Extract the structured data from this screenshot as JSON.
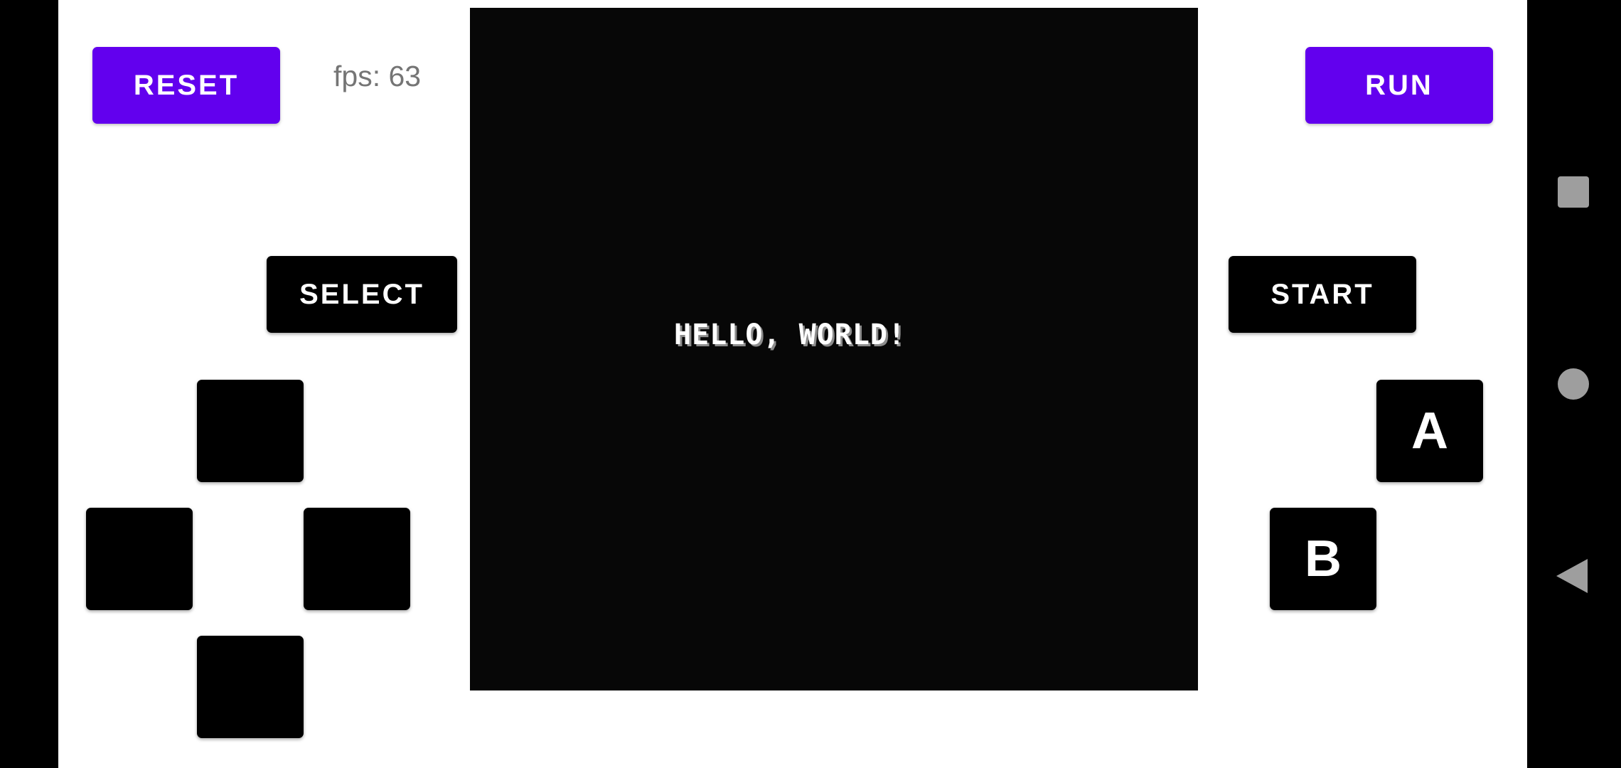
{
  "toolbar": {
    "reset_label": "RESET",
    "run_label": "RUN",
    "fps_text": "fps: 63"
  },
  "screen": {
    "text": "HELLO, WORLD!"
  },
  "controls": {
    "select_label": "SELECT",
    "start_label": "START",
    "a_label": "A",
    "b_label": "B"
  },
  "nav": {
    "recents_icon": "square-icon",
    "home_icon": "circle-icon",
    "back_icon": "triangle-back-icon"
  },
  "colors": {
    "accent": "#6200ee",
    "button_dark": "#000000",
    "screen_bg": "#070707",
    "fps_text": "#757575"
  }
}
